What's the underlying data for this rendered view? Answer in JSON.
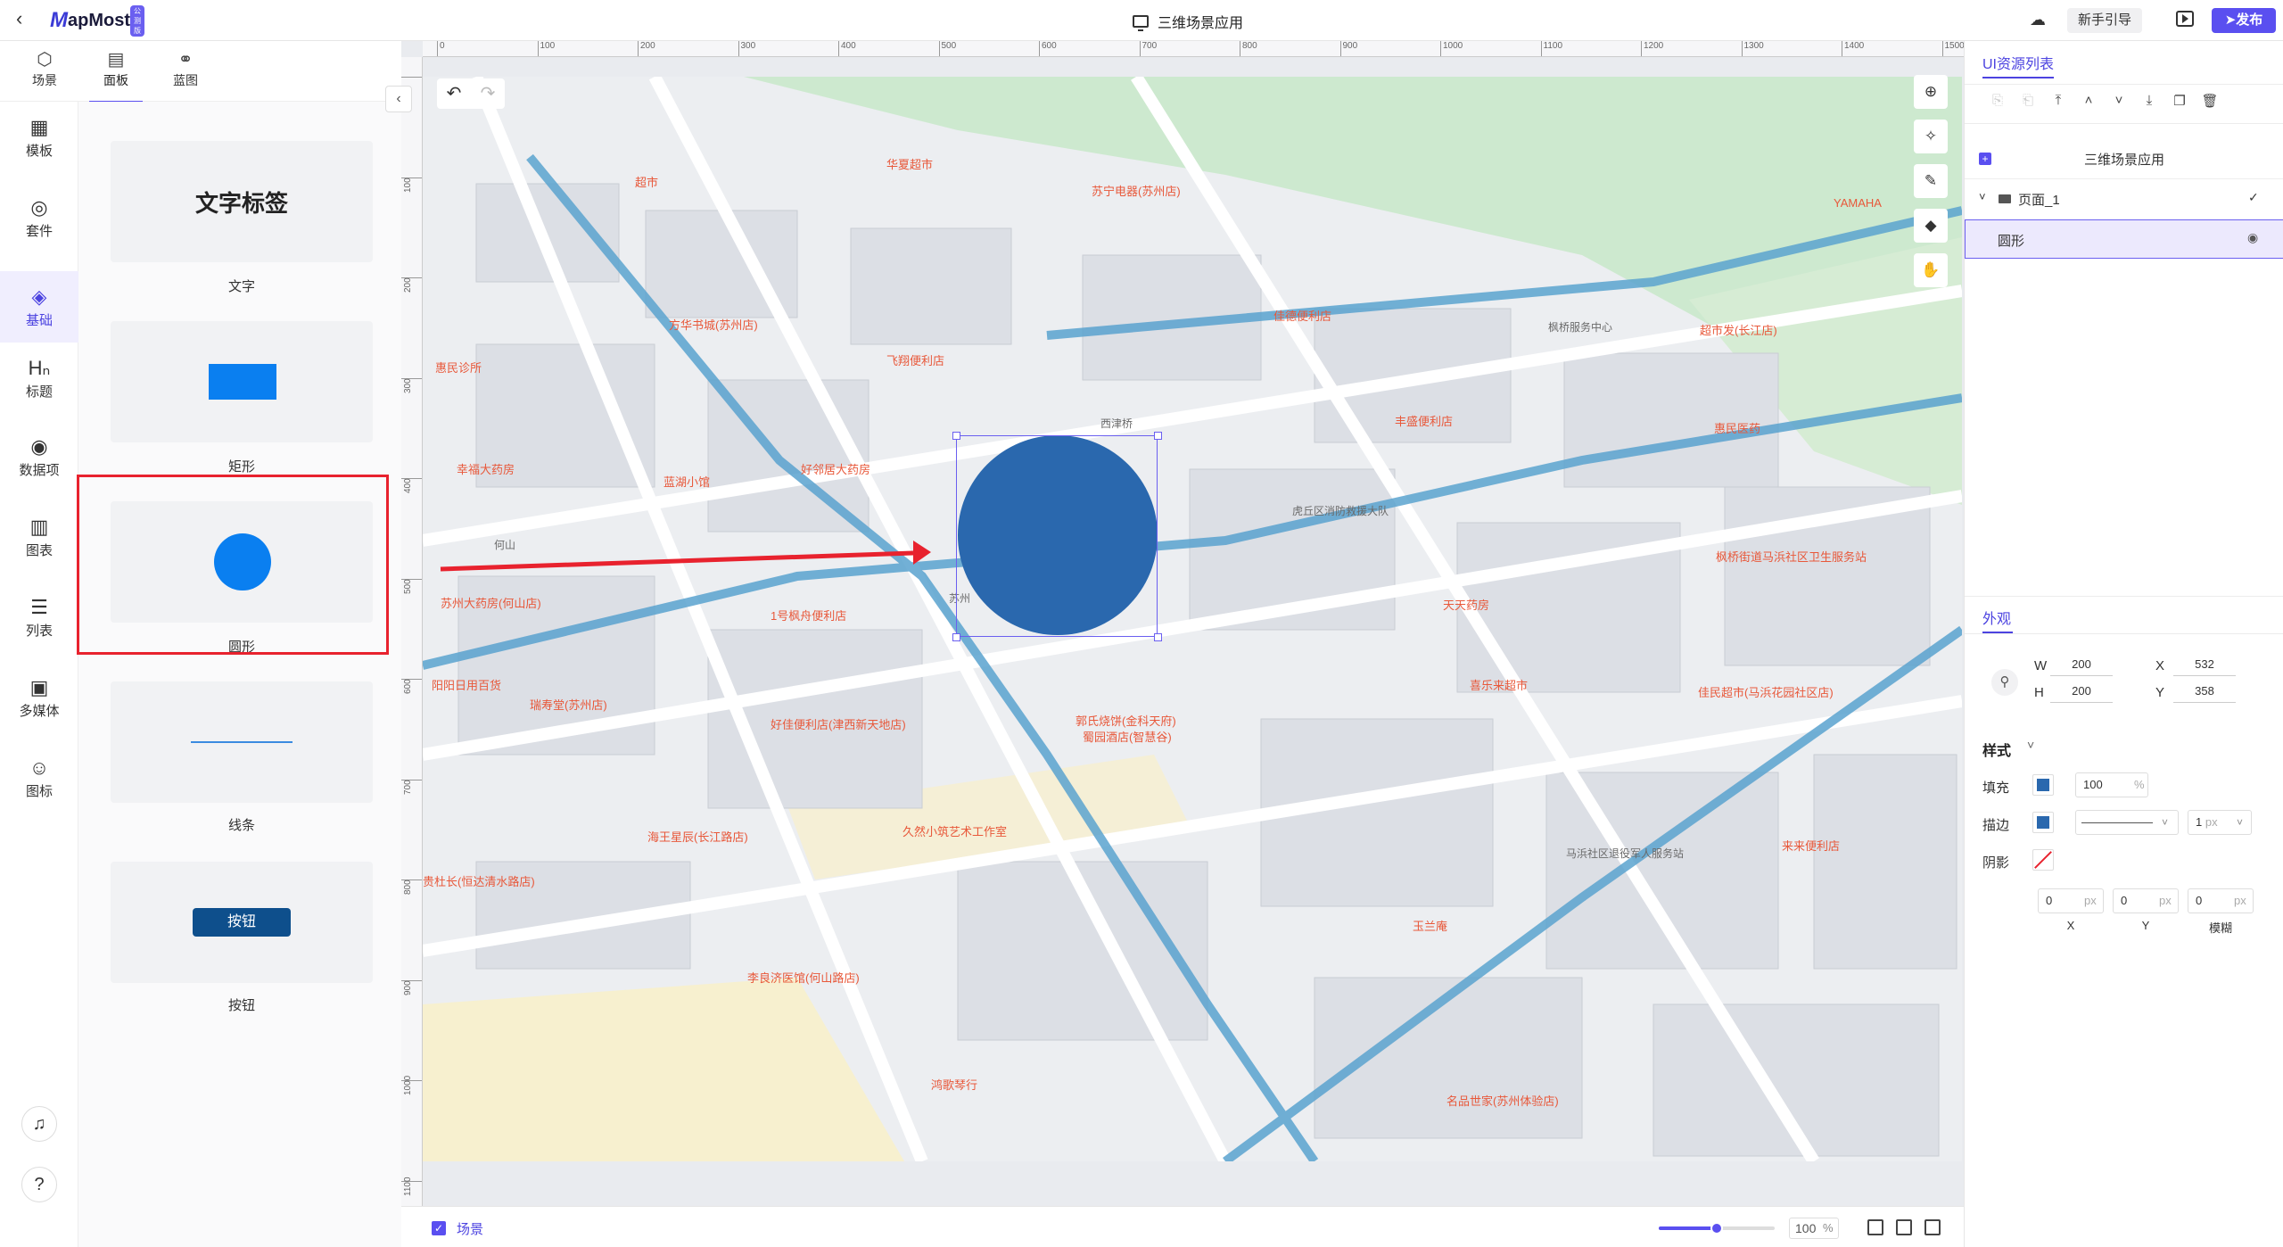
{
  "app": {
    "logo_mark": "M",
    "logo_text": "apMost",
    "logo_badge": "公测版",
    "title": "三维场景应用",
    "guide_label": "新手引导",
    "publish_label": "发布"
  },
  "top_tabs": [
    {
      "label": "场景",
      "icon": "scene-icon"
    },
    {
      "label": "面板",
      "icon": "panel-icon"
    },
    {
      "label": "蓝图",
      "icon": "blueprint-icon"
    }
  ],
  "left_rail": [
    {
      "label": "模板",
      "icon": "template-icon"
    },
    {
      "label": "套件",
      "icon": "kit-icon"
    },
    {
      "label": "基础",
      "icon": "basic-icon"
    },
    {
      "label": "标题",
      "icon": "heading-icon"
    },
    {
      "label": "数据项",
      "icon": "data-item-icon"
    },
    {
      "label": "图表",
      "icon": "chart-icon"
    },
    {
      "label": "列表",
      "icon": "list-icon"
    },
    {
      "label": "多媒体",
      "icon": "media-icon"
    },
    {
      "label": "图标",
      "icon": "emoji-icon"
    }
  ],
  "panel": {
    "text_card": {
      "preview": "文字标签",
      "label": "文字"
    },
    "rect_card": {
      "label": "矩形"
    },
    "circle_card": {
      "label": "圆形"
    },
    "line_card": {
      "label": "线条"
    },
    "button_card": {
      "preview": "按钮",
      "label": "按钮"
    }
  },
  "ruler": {
    "h_ticks": [
      "0",
      "100",
      "200",
      "300",
      "400",
      "500",
      "600",
      "700",
      "800",
      "900",
      "1000",
      "1100",
      "1200",
      "1300",
      "1400",
      "1500"
    ],
    "v_ticks": [
      "0",
      "100",
      "200",
      "300",
      "400",
      "500",
      "600",
      "700",
      "800",
      "900",
      "1000",
      "1100"
    ]
  },
  "map_labels": [
    {
      "text": "超市",
      "cls": ""
    },
    {
      "text": "华夏超市",
      "cls": ""
    },
    {
      "text": "苏宁电器(苏州店)",
      "cls": ""
    },
    {
      "text": "方华书城(苏州店)",
      "cls": ""
    },
    {
      "text": "飞翔便利店",
      "cls": ""
    },
    {
      "text": "惠民诊所",
      "cls": ""
    },
    {
      "text": "幸福大药房",
      "cls": ""
    },
    {
      "text": "好邻居大药房",
      "cls": ""
    },
    {
      "text": "蓝湖小馆",
      "cls": ""
    },
    {
      "text": "苏州大药房(何山店)",
      "cls": ""
    },
    {
      "text": "1号枫舟便利店",
      "cls": ""
    },
    {
      "text": "阳阳日用百货",
      "cls": ""
    },
    {
      "text": "瑞寿堂(苏州店)",
      "cls": ""
    },
    {
      "text": "好佳便利店(津西新天地店)",
      "cls": ""
    },
    {
      "text": "郭氏烧饼(金科天府)",
      "cls": ""
    },
    {
      "text": "蜀园酒店(智慧谷)",
      "cls": ""
    },
    {
      "text": "海王星辰(长江路店)",
      "cls": ""
    },
    {
      "text": "久然小筑艺术工作室",
      "cls": ""
    },
    {
      "text": "贵杜长(恒达清水路店)",
      "cls": ""
    },
    {
      "text": "李良济医馆(何山路店)",
      "cls": ""
    },
    {
      "text": "鸿歌琴行",
      "cls": ""
    },
    {
      "text": "玉兰庵",
      "cls": ""
    },
    {
      "text": "名品世家(苏州体验店)",
      "cls": ""
    },
    {
      "text": "马浜社区退役军人服务站",
      "cls": "gray"
    },
    {
      "text": "来来便利店",
      "cls": ""
    },
    {
      "text": "佳民超市(马浜花园社区店)",
      "cls": ""
    },
    {
      "text": "喜乐来超市",
      "cls": ""
    },
    {
      "text": "天天药房",
      "cls": ""
    },
    {
      "text": "枫桥街道马浜社区卫生服务站",
      "cls": ""
    },
    {
      "text": "虎丘区消防救援大队",
      "cls": "gray"
    },
    {
      "text": "西津桥",
      "cls": "gray"
    },
    {
      "text": "何山",
      "cls": "gray"
    },
    {
      "text": "苏州",
      "cls": "gray"
    },
    {
      "text": "丰盛便利店",
      "cls": ""
    },
    {
      "text": "佳德便利店",
      "cls": ""
    },
    {
      "text": "枫桥服务中心",
      "cls": "gray"
    },
    {
      "text": "超市发(长江店)",
      "cls": ""
    },
    {
      "text": "惠民医药",
      "cls": ""
    },
    {
      "text": "YAMAHA",
      "cls": ""
    }
  ],
  "bottom": {
    "scene_label": "场景",
    "zoom_value": "100",
    "zoom_unit": "%",
    "zoom_fraction": 0.5
  },
  "right_panel": {
    "title": "UI资源列表",
    "tree": {
      "root": "三维场景应用",
      "page": "页面_1",
      "item": "圆形"
    },
    "appearance_title": "外观",
    "w_label": "W",
    "w_value": "200",
    "h_label": "H",
    "h_value": "200",
    "x_label": "X",
    "x_value": "532",
    "y_label": "Y",
    "y_value": "358",
    "style_title": "样式",
    "fill_label": "填充",
    "fill_opacity": "100",
    "fill_unit": "%",
    "fill_color": "#2a68ae",
    "stroke_label": "描边",
    "stroke_width": "1",
    "stroke_unit": "px",
    "stroke_color": "#2a68ae",
    "shadow_label": "阴影",
    "shadow_x": "0",
    "shadow_y": "0",
    "shadow_blur": "0",
    "shadow_unit": "px",
    "shadow_x_label": "X",
    "shadow_y_label": "Y",
    "shadow_blur_label": "模糊"
  },
  "colors": {
    "accent": "#5a4ff0",
    "shape_fill": "#2a68ae",
    "highlight_box": "#e8222e",
    "arrow": "#e8222e"
  }
}
